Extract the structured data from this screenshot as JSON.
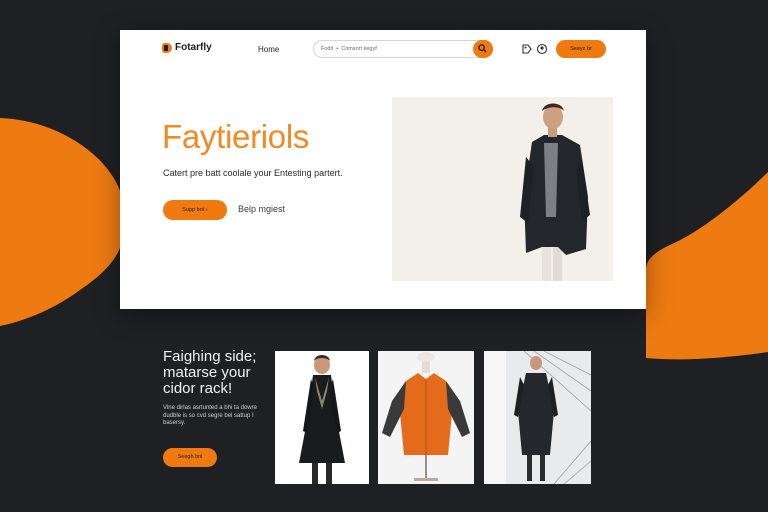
{
  "brand": {
    "name": "Fotarfly",
    "logo_icon": "brand-logo-icon"
  },
  "nav": {
    "home_label": "Home",
    "cta_label": "Seeyz br"
  },
  "search": {
    "value": "Fodit  •  Comsort kegyf",
    "icons": [
      "search-icon"
    ]
  },
  "header_icons": [
    "tag-icon",
    "user-icon"
  ],
  "hero": {
    "title": "Faytieriols",
    "subtitle": "Catert pre batt coolale your Entesting partert.",
    "primary_button": "Supp bnt  ›",
    "secondary_link": "Belp mgiest"
  },
  "section2": {
    "title": "Faighing side; matarse your cidor rack!",
    "description": "Vine dirlas asrtunted a bhi ta dowre dudble is so cvd segre bel sattup I basersy.",
    "button": "Seegh bnl"
  },
  "colors": {
    "accent": "#f07a10",
    "background": "#1f2023",
    "card": "#ffffff"
  }
}
